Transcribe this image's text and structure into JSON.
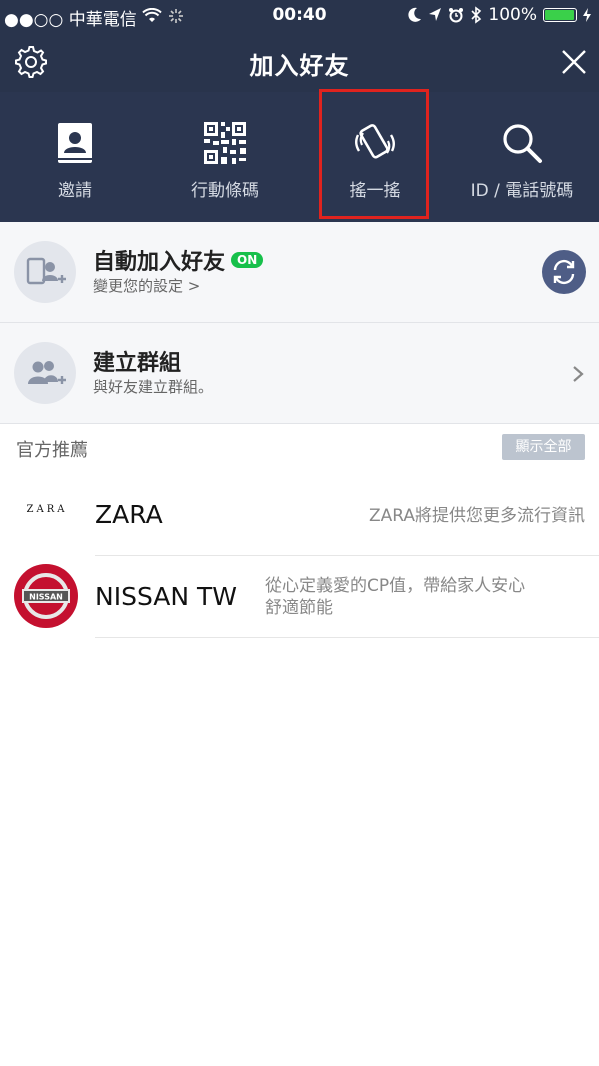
{
  "status_bar": {
    "carrier": "●●○○ 中華電信",
    "time": "00:40",
    "battery": "100%"
  },
  "header": {
    "title": "加入好友",
    "settings_icon": "gear-icon",
    "close_icon": "close-icon"
  },
  "tabs": [
    {
      "label": "邀請",
      "icon": "contact-card-icon"
    },
    {
      "label": "行動條碼",
      "icon": "qr-code-icon"
    },
    {
      "label": "搖一搖",
      "icon": "shake-phone-icon",
      "highlighted": true
    },
    {
      "label": "ID / 電話號碼",
      "icon": "search-icon"
    }
  ],
  "auto_add": {
    "title": "自動加入好友",
    "badge": "ON",
    "subtitle": "變更您的設定 >"
  },
  "create_group": {
    "title": "建立群組",
    "subtitle": "與好友建立群組。"
  },
  "official": {
    "section_title": "官方推薦",
    "show_all": "顯示全部",
    "items": [
      {
        "logo_text": "ZARA",
        "name": "ZARA",
        "description": "ZARA將提供您更多流行資訊"
      },
      {
        "logo_text": "NISSAN",
        "name": "NISSAN TW",
        "description_line1": "從心定義愛的CP值，帶給家人安心",
        "description_line2": "舒適節能"
      }
    ]
  },
  "colors": {
    "header_bg": "#29344c",
    "highlight": "#e0231e",
    "on_badge": "#17c04b"
  }
}
